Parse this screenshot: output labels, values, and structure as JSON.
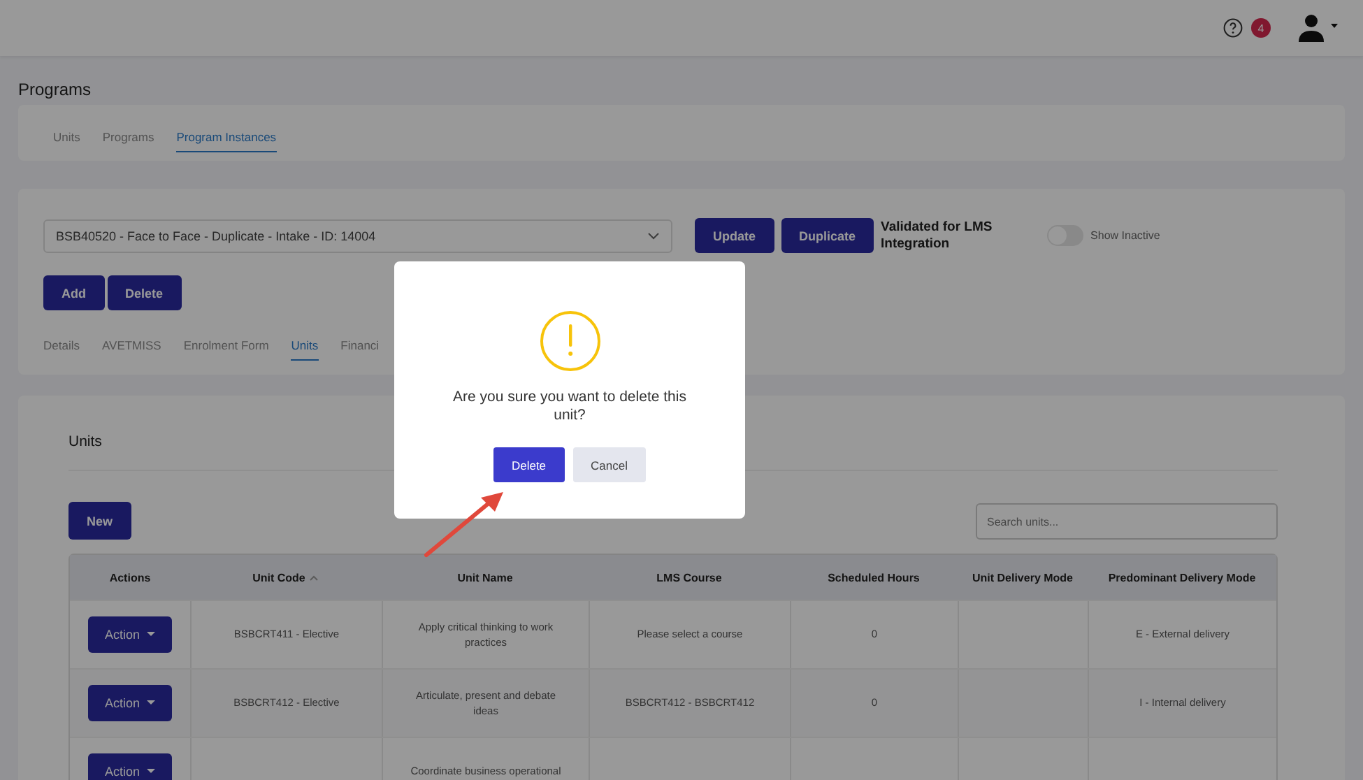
{
  "topbar": {
    "notifications": "4"
  },
  "page_title": "Programs",
  "main_tabs": [
    {
      "label": "Units",
      "selected": false
    },
    {
      "label": "Programs",
      "selected": false
    },
    {
      "label": "Program Instances",
      "selected": true
    }
  ],
  "instance": {
    "value": "BSB40520 - Face to Face - Duplicate - Intake - ID: 14004",
    "buttons": [
      "Update",
      "Duplicate"
    ],
    "validated_label": "Validated for LMS Integration",
    "show_inactive": {
      "label": "Show Inactive",
      "on": false
    }
  },
  "instance_buttons": [
    "Add",
    "Delete"
  ],
  "sub_tabs": [
    {
      "label": "Details",
      "selected": false
    },
    {
      "label": "AVETMISS",
      "selected": false
    },
    {
      "label": "Enrolment Form",
      "selected": false
    },
    {
      "label": "Units",
      "selected": true
    },
    {
      "label": "Financi",
      "selected": false
    }
  ],
  "units": {
    "title": "Units",
    "new_button": "New",
    "search": {
      "placeholder": "Search units..."
    },
    "columns": [
      {
        "label": "Actions",
        "sorted": false
      },
      {
        "label": "Unit Code",
        "sorted": true
      },
      {
        "label": "Unit Name",
        "sorted": false
      },
      {
        "label": "LMS Course",
        "sorted": false
      },
      {
        "label": "Scheduled Hours",
        "sorted": false
      },
      {
        "label": "Unit Delivery Mode",
        "sorted": false
      },
      {
        "label": "Predominant Delivery Mode",
        "sorted": false
      }
    ],
    "rows": [
      {
        "cells": [
          "Action",
          "BSBCRT411 - Elective",
          "Apply critical thinking to work practices",
          "Please select a course",
          "0",
          "",
          "E - External delivery"
        ]
      },
      {
        "cells": [
          "Action",
          "BSBCRT412 - Elective",
          "Articulate, present and debate ideas",
          "BSBCRT412 - BSBCRT412",
          "0",
          "",
          "I - Internal delivery"
        ]
      },
      {
        "cells": [
          "Action",
          "",
          "Coordinate business operational",
          "",
          "",
          "",
          ""
        ]
      }
    ]
  },
  "dialog": {
    "message": "Are you sure you want to delete this unit?",
    "buttons": [
      {
        "label": "Delete",
        "kind": "primary"
      },
      {
        "label": "Cancel",
        "kind": "secondary"
      }
    ]
  }
}
